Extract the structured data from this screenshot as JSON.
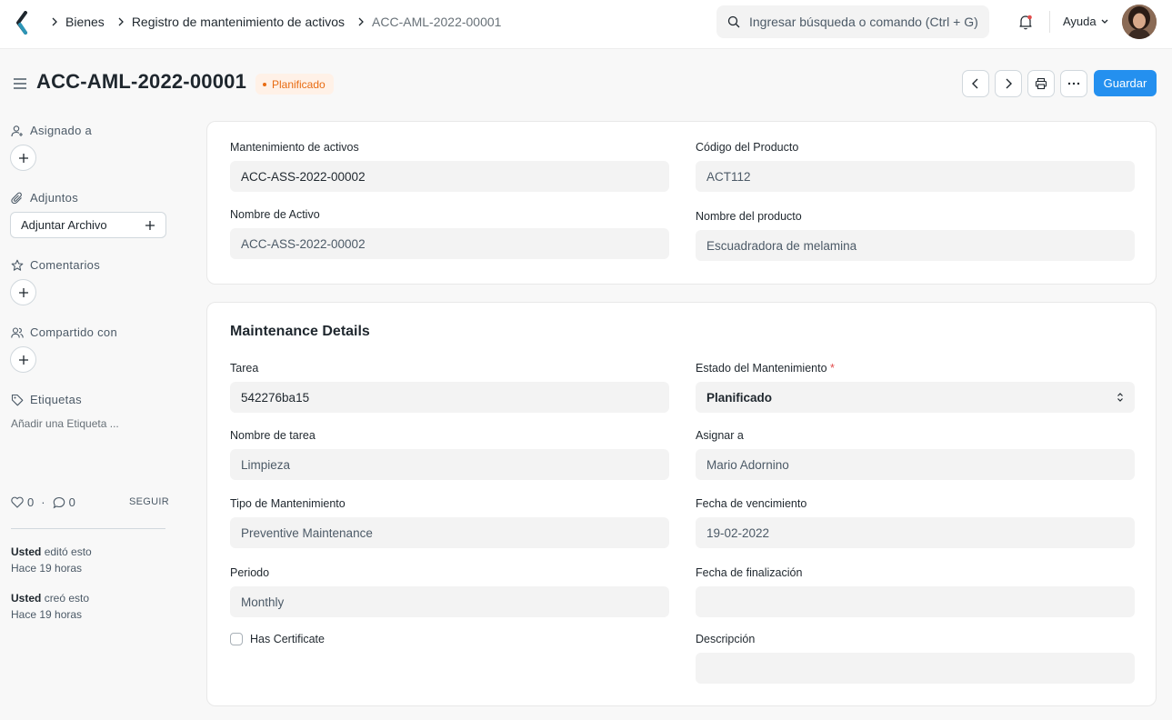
{
  "navbar": {
    "breadcrumbs": [
      "Bienes",
      "Registro de mantenimiento de activos",
      "ACC-AML-2022-00001"
    ],
    "search_placeholder": "Ingresar búsqueda o comando (Ctrl + G)",
    "help_label": "Ayuda"
  },
  "page": {
    "title": "ACC-AML-2022-00001",
    "status": "Planificado",
    "save_label": "Guardar"
  },
  "sidebar": {
    "assigned_label": "Asignado a",
    "attachments_label": "Adjuntos",
    "attach_button": "Adjuntar Archivo",
    "comments_label": "Comentarios",
    "shared_label": "Compartido con",
    "tags_label": "Etiquetas",
    "tag_hint": "Añadir una Etiqueta ...",
    "likes": "0",
    "comments_count": "0",
    "follow_label": "SEGUIR",
    "activity": [
      {
        "user": "Usted",
        "action": "editó esto",
        "time": "Hace 19 horas"
      },
      {
        "user": "Usted",
        "action": "creó esto",
        "time": "Hace 19 horas"
      }
    ]
  },
  "card1": {
    "asset_maintenance_label": "Mantenimiento de activos",
    "asset_maintenance_value": "ACC-ASS-2022-00002",
    "item_code_label": "Código del Producto",
    "item_code_value": "ACT112",
    "asset_name_label": "Nombre de Activo",
    "asset_name_value": "ACC-ASS-2022-00002",
    "item_name_label": "Nombre del producto",
    "item_name_value": "Escuadradora de melamina"
  },
  "card2": {
    "section_title": "Maintenance Details",
    "task_label": "Tarea",
    "task_value": "542276ba15",
    "status_label": "Estado del Mantenimiento",
    "status_required": "*",
    "status_value": "Planificado",
    "task_name_label": "Nombre de tarea",
    "task_name_value": "Limpieza",
    "assign_to_label": "Asignar a",
    "assign_to_value": "Mario Adornino",
    "maint_type_label": "Tipo de Mantenimiento",
    "maint_type_value": "Preventive Maintenance",
    "due_date_label": "Fecha de vencimiento",
    "due_date_value": "19-02-2022",
    "period_label": "Periodo",
    "period_value": "Monthly",
    "completion_date_label": "Fecha de finalización",
    "completion_date_value": "",
    "certificate_label": "Has Certificate",
    "description_label": "Descripción",
    "description_value": ""
  },
  "colors": {
    "primary": "#2490ef",
    "status_orange": "#e86c13",
    "status_bg": "#fff1e7"
  }
}
